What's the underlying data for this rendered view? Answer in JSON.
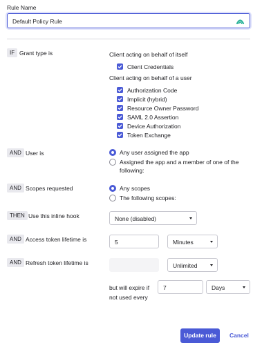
{
  "rule_name": {
    "label": "Rule Name",
    "value": "Default Policy Rule",
    "icon": "password-manager-icon"
  },
  "grant": {
    "badge": "IF",
    "label": "Grant type is",
    "self_heading": "Client acting on behalf of itself",
    "self_options": [
      "Client Credentials"
    ],
    "user_heading": "Client acting on behalf of a user",
    "user_options": [
      "Authorization Code",
      "Implicit (hybrid)",
      "Resource Owner Password",
      "SAML 2.0 Assertion",
      "Device Authorization",
      "Token Exchange"
    ]
  },
  "user": {
    "badge": "AND",
    "label": "User is",
    "option_any": "Any user assigned the app",
    "option_assigned_line1": "Assigned the app and a member of one of the",
    "option_assigned_line2": "following:"
  },
  "scopes": {
    "badge": "AND",
    "label": "Scopes requested",
    "option_any": "Any scopes",
    "option_following": "The following scopes:"
  },
  "hook": {
    "badge": "THEN",
    "label": "Use this inline hook",
    "selected": "None (disabled)"
  },
  "access_token": {
    "badge": "AND",
    "label": "Access token lifetime is",
    "value": "5",
    "unit": "Minutes"
  },
  "refresh_token": {
    "badge": "AND",
    "label": "Refresh token lifetime is",
    "value": "",
    "unit": "Unlimited",
    "expire_line1": "but will expire if",
    "expire_line2": "not used every",
    "expire_value": "7",
    "expire_unit": "Days"
  },
  "actions": {
    "update": "Update rule",
    "cancel": "Cancel"
  },
  "colors": {
    "accent": "#4a5ad6",
    "badge_bg": "#e9e9ee",
    "border": "#c7c7cf"
  }
}
